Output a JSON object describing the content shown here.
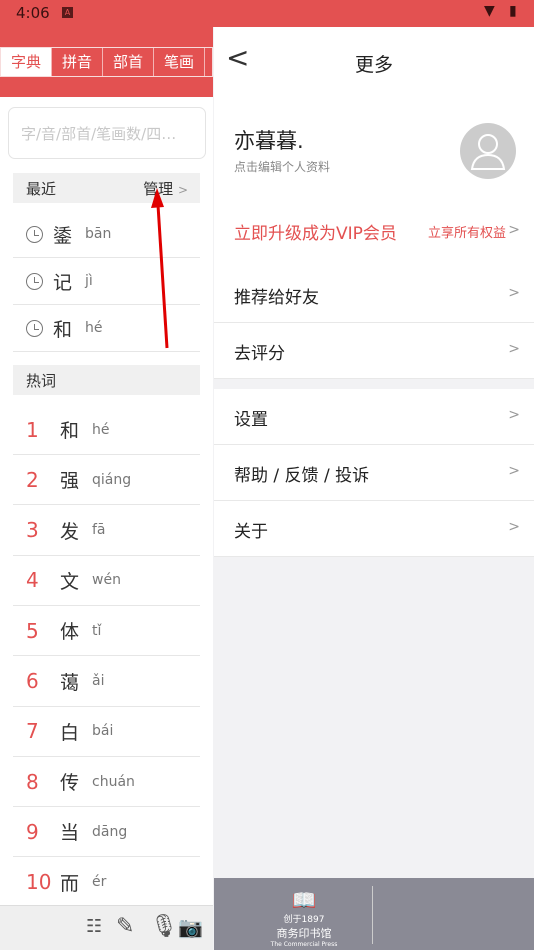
{
  "status": {
    "time": "4:06",
    "icons": [
      "notification-a-icon",
      "wifi-icon",
      "battery-icon"
    ]
  },
  "left": {
    "tabs": [
      "字典",
      "拼音",
      "部首",
      "笔画"
    ],
    "search_placeholder": "字/音/部首/笔画数/四…",
    "recent": {
      "title": "最近",
      "manage": "管理",
      "items": [
        {
          "char": "鋈",
          "pinyin": "bān"
        },
        {
          "char": "记",
          "pinyin": "jì"
        },
        {
          "char": "和",
          "pinyin": "hé"
        }
      ]
    },
    "hot": {
      "title": "热词",
      "items": [
        {
          "rank": "1",
          "char": "和",
          "pinyin": "hé"
        },
        {
          "rank": "2",
          "char": "强",
          "pinyin": "qiáng"
        },
        {
          "rank": "3",
          "char": "发",
          "pinyin": "fā"
        },
        {
          "rank": "4",
          "char": "文",
          "pinyin": "wén"
        },
        {
          "rank": "5",
          "char": "体",
          "pinyin": "tǐ"
        },
        {
          "rank": "6",
          "char": "蔼",
          "pinyin": "ǎi"
        },
        {
          "rank": "7",
          "char": "白",
          "pinyin": "bái"
        },
        {
          "rank": "8",
          "char": "传",
          "pinyin": "chuán"
        },
        {
          "rank": "9",
          "char": "当",
          "pinyin": "dāng"
        },
        {
          "rank": "10",
          "char": "而",
          "pinyin": "ér"
        }
      ]
    },
    "toolbar": [
      "list-icon",
      "pencil-icon",
      "microphone-icon",
      "camera-icon"
    ]
  },
  "right": {
    "title": "更多",
    "profile": {
      "name": "亦暮暮.",
      "subtitle": "点击编辑个人资料"
    },
    "vip": {
      "label": "立即升级成为VIP会员",
      "sub": "立享所有权益"
    },
    "group1": [
      "推荐给好友",
      "去评分"
    ],
    "group2": [
      "设置",
      "帮助 / 反馈 / 投诉",
      "关于"
    ],
    "footer_logo": {
      "line1": "创于1897",
      "line2": "商务印书馆",
      "line3": "The Commercial Press"
    }
  },
  "colors": {
    "accent": "#e35151",
    "annotation_arrow": "#e00000"
  }
}
